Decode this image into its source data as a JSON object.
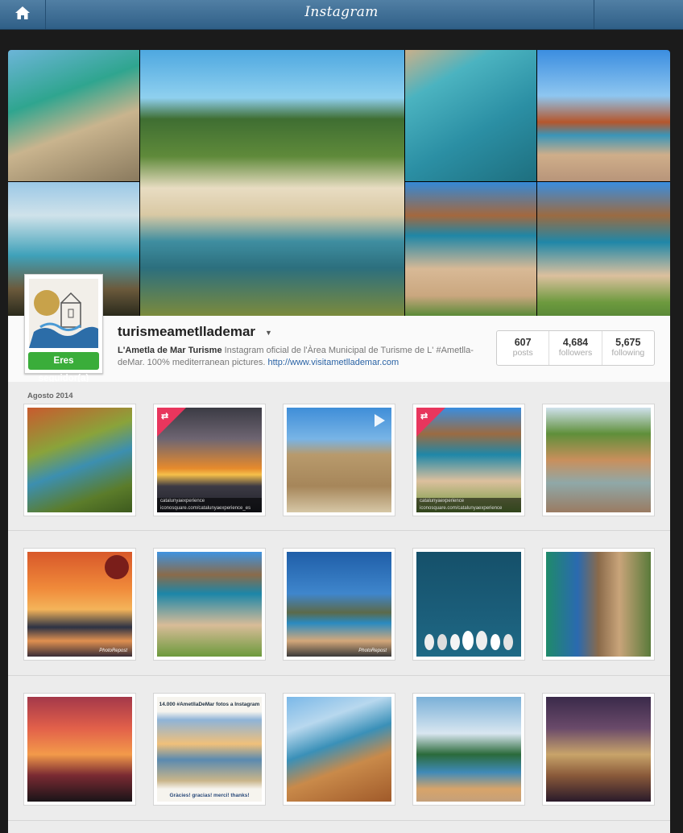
{
  "app": {
    "logo": "Instagram"
  },
  "nav": {
    "home_icon": "home-icon"
  },
  "profile": {
    "username": "turismeametllademar",
    "display_name": "L'Ametla de Mar Turisme",
    "bio": "Instagram oficial de l'Àrea Municipal de Turisme de L' #Ametlla-deMar. 100% mediterranean pictures.",
    "website": "http://www.visitametllademar.com",
    "follow_status": "Eres seguidor(a)",
    "stats": {
      "posts": "607",
      "posts_label": "posts",
      "followers": "4,684",
      "followers_label": "followers",
      "following": "5,675",
      "following_label": "following"
    }
  },
  "feed": {
    "month_label": "Agosto 2014",
    "credits": {
      "catalunya1": "catalunyaexperience",
      "catalunya1_sub": "iconosquare.com/catalunyaexperience_es",
      "catalunya2": "catalunyaexperience",
      "catalunya2_sub": "iconosquare.com/catalunyaexperience",
      "photorepost": "PhotoRepost",
      "caption_top": "14.000 #AmetllaDeMar fotos a Instagram",
      "caption_bottom": "Gràcies! gracias! merci! thanks!"
    }
  },
  "colors": {
    "nav": "#3f6e94",
    "follow_badge": "#3aad3a",
    "repost_badge": "#e8365d",
    "link": "#2a63a5"
  }
}
